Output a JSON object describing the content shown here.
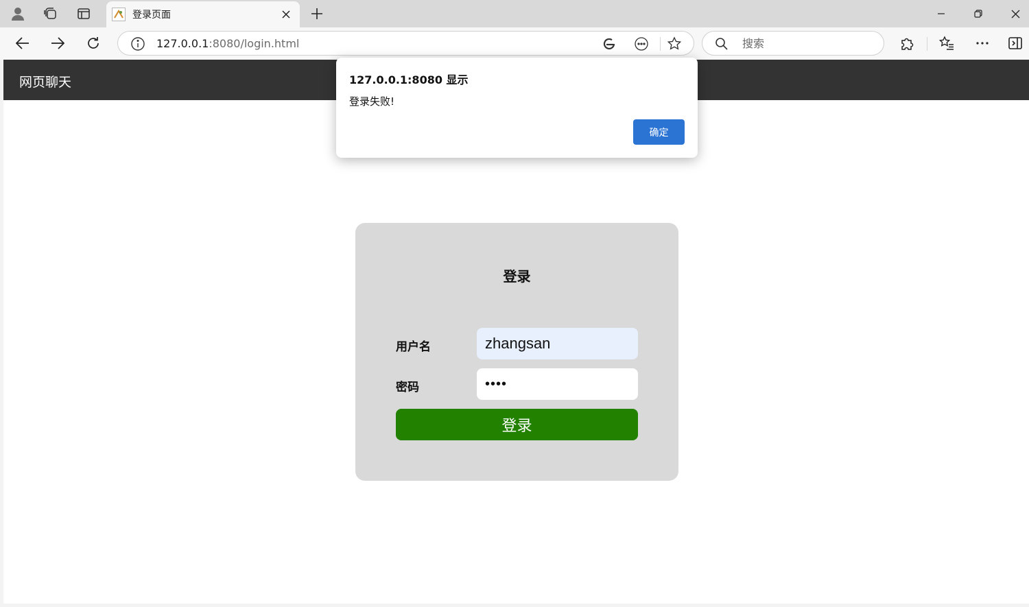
{
  "browser": {
    "tab": {
      "title": "登录页面"
    },
    "address": {
      "host": "127.0.0.1",
      "rest": ":8080/login.html"
    },
    "search": {
      "placeholder": "搜索"
    }
  },
  "page": {
    "site_title": "网页聊天",
    "login": {
      "heading": "登录",
      "username_label": "用户名",
      "username_value": "zhangsan",
      "password_label": "密码",
      "password_value": "1234",
      "submit_label": "登录"
    }
  },
  "dialog": {
    "title": "127.0.0.1:8080 显示",
    "message": "登录失败!",
    "ok_label": "确定"
  },
  "colors": {
    "header_bg": "#333333",
    "card_bg": "#d9d9d9",
    "login_button": "#228200",
    "dialog_ok": "#2b74d4"
  }
}
